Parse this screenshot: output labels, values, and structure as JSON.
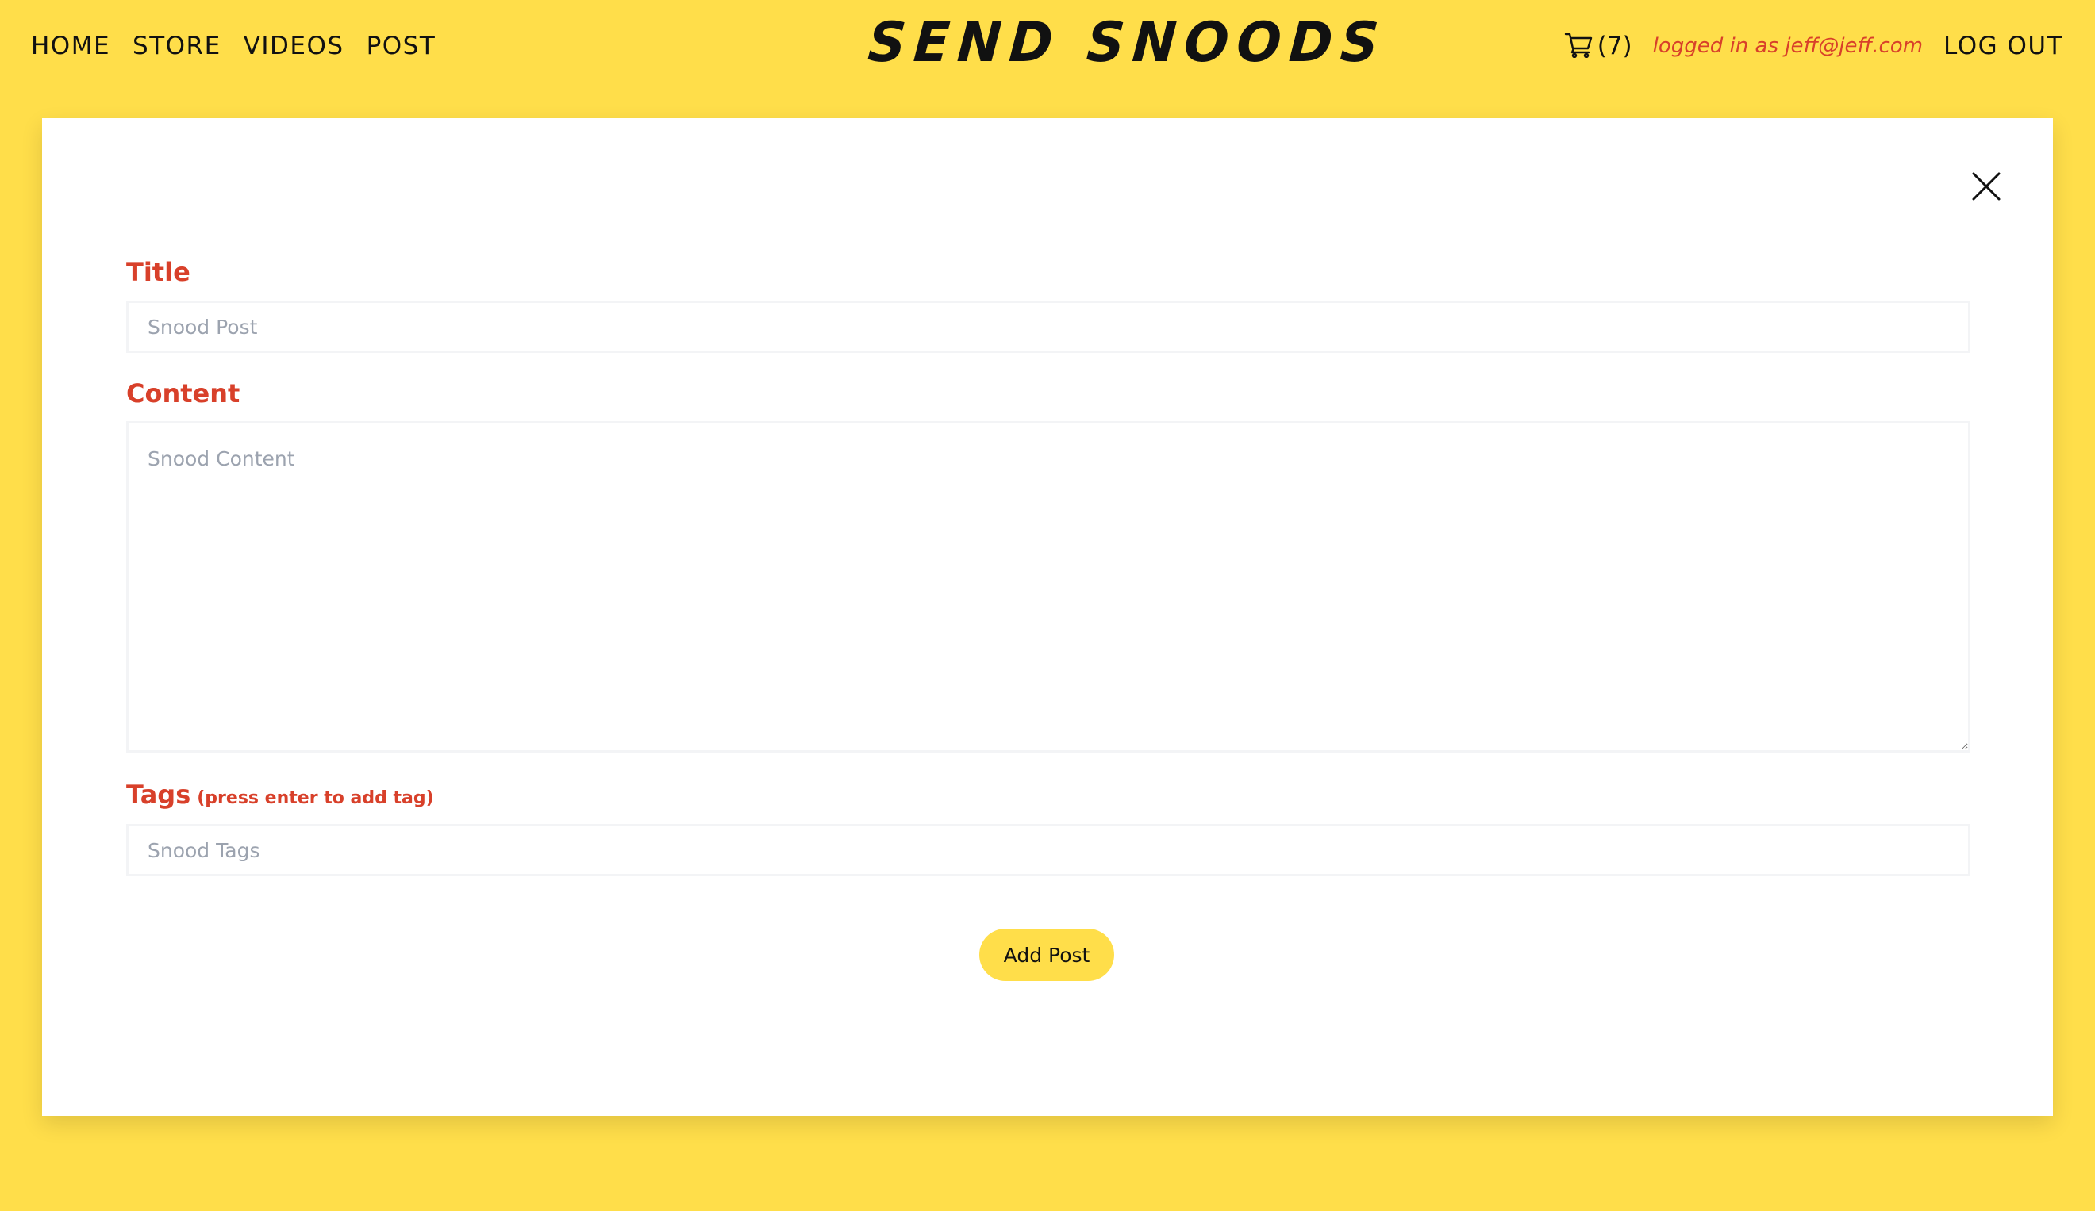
{
  "nav": {
    "links": [
      "HOME",
      "STORE",
      "VIDEOS",
      "POST"
    ],
    "brand": "SEND SNOODS",
    "cart_count": "(7)",
    "login_status": "logged in as jeff@jeff.com",
    "logout": "LOG OUT"
  },
  "colors": {
    "background": "#FFDE4A",
    "label": "#D8402A",
    "button": "#FFDE4A"
  },
  "icons": {
    "cart": "cart-icon",
    "close": "close-icon"
  },
  "form": {
    "title_label": "Title",
    "title_placeholder": "Snood Post",
    "content_label": "Content",
    "content_placeholder": "Snood Content",
    "tags_label": "Tags",
    "tags_hint": "(press enter to add tag)",
    "tags_placeholder": "Snood Tags",
    "submit_label": "Add Post"
  }
}
